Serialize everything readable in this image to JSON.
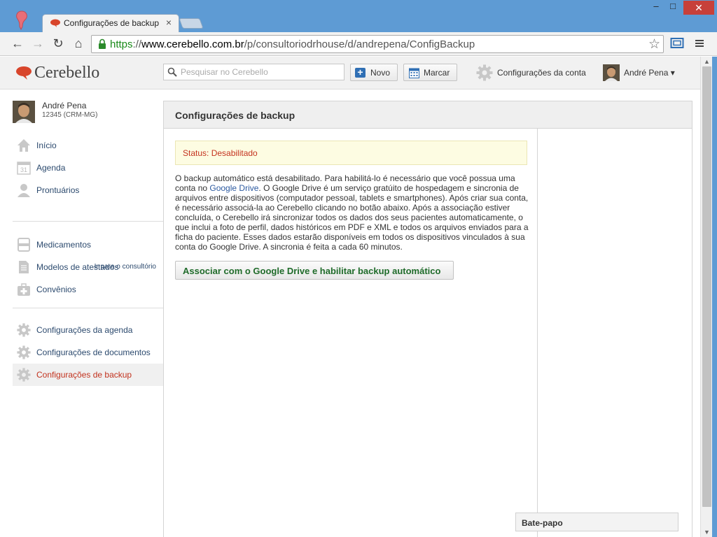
{
  "browser": {
    "tab_title": "Configurações de backup",
    "tab_close": "×",
    "url_scheme": "https",
    "url_sep": "://",
    "url_host": "www.cerebello.com.br",
    "url_path": "/p/consultoriodrhouse/d/andrepena/ConfigBackup",
    "back": "←",
    "forward": "→",
    "reload": "↻",
    "home": "⌂",
    "star": "☆",
    "min": "‒",
    "max": "□",
    "close": "✕"
  },
  "header": {
    "brand": "Cerebello",
    "search_placeholder": "Pesquisar no Cerebello",
    "new_label": "Novo",
    "schedule_label": "Marcar",
    "account_settings_label": "Configurações da conta",
    "user_name": "André Pena ▾"
  },
  "sidebar": {
    "profile_name": "André Pena",
    "profile_crm": "12345 (CRM-MG)",
    "items": [
      {
        "label": "Início",
        "icon": "home-icon"
      },
      {
        "label": "Agenda",
        "icon": "calendar-icon"
      },
      {
        "label": "Prontuários",
        "icon": "person-icon"
      },
      {
        "label": "Medicamentos",
        "icon": "medication-icon"
      },
      {
        "label": "Modelos de atestados",
        "icon": "document-icon"
      },
      {
        "label": "Convênios",
        "icon": "first-aid-icon"
      },
      {
        "label": "Configurações da agenda",
        "icon": "gear-icon"
      },
      {
        "label": "Configurações de documentos",
        "icon": "gear-icon"
      },
      {
        "label": "Configurações de backup",
        "icon": "gear-icon"
      }
    ],
    "goto_clinic": "Ir para o consultório"
  },
  "main": {
    "title": "Configurações de backup",
    "status": "Status: Desabilitado",
    "desc_part1": "O backup automático está desabilitado. Para habilitá-lo é necessário que você possua uma conta no ",
    "desc_link": "Google Drive",
    "desc_part2": ". O Google Drive é um serviço gratúito de hospedagem e sincronia de arquivos entre dispositivos (computador pessoal, tablets e smartphones). Após criar sua conta, é necessário associá-la ao Cerebello clicando no botão abaixo. Após a associação estiver concluída, o Cerebello irá sincronizar todos os dados dos seus pacientes automaticamente, o que inclui a foto de perfil, dados históricos em PDF e XML e todos os arquivos enviados para a ficha do paciente. Esses dados estarão disponíveis em todos os dispositivos vinculados à sua conta do Google Drive. A sincronia é feita a cada 60 minutos.",
    "gdrive_button": "Associar com o Google Drive e habilitar backup automático"
  },
  "chat": {
    "label": "Bate-papo"
  },
  "colors": {
    "accent": "#c2321e",
    "link": "#2c4a6e",
    "brand_red": "#d8452b",
    "titlebar": "#5e9bd4"
  }
}
